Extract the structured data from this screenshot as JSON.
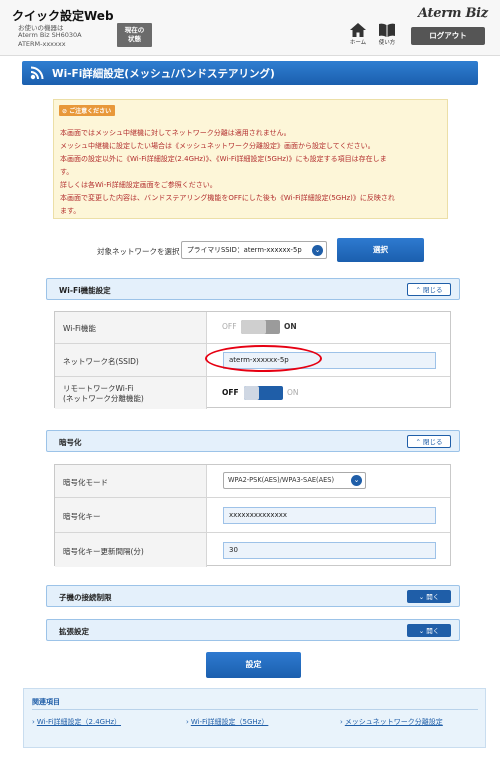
{
  "header": {
    "site_title": "クイック設定Web",
    "device_label": "お使いの機器は",
    "device_model": "Aterm Biz SH6030A",
    "device_name": "ATERM-xxxxxx",
    "status_button": "現在の\n状態",
    "home_label": "ホーム",
    "manual_label": "使い方",
    "brand": "Aterm Biz",
    "logout_button": "ログアウト"
  },
  "page_title": "Wi-Fi詳細設定(メッシュ/バンドステアリング)",
  "notice": {
    "tag": "ご注意ください",
    "lines": [
      "本画面ではメッシュ中継機に対してネットワーク分離は適用されません。",
      "メッシュ中継機に設定したい場合は《メッシュネットワーク分離設定》画面から設定してください。",
      "本画面の設定以外に《Wi-Fi詳細設定(2.4GHz)》、《Wi-Fi詳細設定(5GHz)》にも設定する項目は存在しま",
      "す。",
      "詳しくは各Wi-Fi詳細設定画面をご参照ください。",
      "本画面で変更した内容は、バンドステアリング機能をOFFにした後も《Wi-Fi詳細設定(5GHz)》に反映され",
      "ます。"
    ]
  },
  "network_select": {
    "label": "対象ネットワークを選択",
    "value": "プライマリSSID：aterm-xxxxxx-5p",
    "button": "選択"
  },
  "wifi_section": {
    "title": "Wi-Fi機能設定",
    "toggle": "閉じる",
    "wifi_label": "Wi-Fi機能",
    "wifi_off": "OFF",
    "wifi_on": "ON",
    "ssid_label": "ネットワーク名(SSID)",
    "ssid_value": "aterm-xxxxxx-5p",
    "remote_label_1": "リモートワークWi-Fi",
    "remote_label_2": "(ネットワーク分離機能)",
    "remote_off": "OFF",
    "remote_on": "ON"
  },
  "encryption_section": {
    "title": "暗号化",
    "toggle": "閉じる",
    "mode_label": "暗号化モード",
    "mode_value": "WPA2-PSK(AES)/WPA3-SAE(AES)",
    "key_label": "暗号化キー",
    "key_value": "xxxxxxxxxxxxxx",
    "interval_label": "暗号化キー更新間隔(分)",
    "interval_value": "30"
  },
  "child_section": {
    "title": "子機の接続制限",
    "toggle": "開く"
  },
  "advanced_section": {
    "title": "拡張設定",
    "toggle": "開く"
  },
  "setting_button": "設定",
  "related": {
    "title": "関連項目",
    "links": [
      "Wi-Fi詳細設定（2.4GHz）",
      "Wi-Fi詳細設定（5GHz）",
      "メッシュネットワーク分離設定"
    ]
  },
  "colors": {
    "primary_blue": "#1f5ea8",
    "notice_text": "#b22e2e",
    "highlight_red": "#e60012"
  }
}
